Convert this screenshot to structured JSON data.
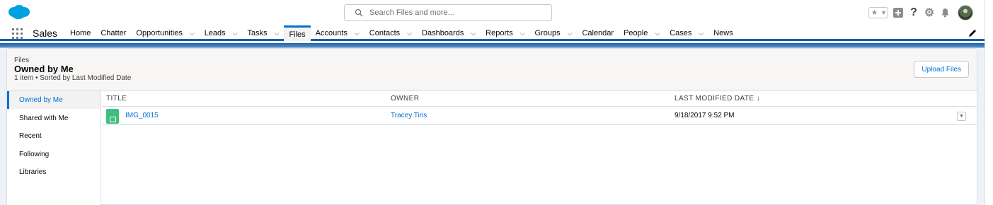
{
  "header": {
    "search_placeholder": "Search Files and more..."
  },
  "nav": {
    "app_name": "Sales",
    "items": [
      {
        "label": "Home",
        "dropdown": false
      },
      {
        "label": "Chatter",
        "dropdown": false
      },
      {
        "label": "Opportunities",
        "dropdown": true
      },
      {
        "label": "Leads",
        "dropdown": true
      },
      {
        "label": "Tasks",
        "dropdown": true
      },
      {
        "label": "Files",
        "dropdown": false,
        "active": true
      },
      {
        "label": "Accounts",
        "dropdown": true
      },
      {
        "label": "Contacts",
        "dropdown": true
      },
      {
        "label": "Dashboards",
        "dropdown": true
      },
      {
        "label": "Reports",
        "dropdown": true
      },
      {
        "label": "Groups",
        "dropdown": true
      },
      {
        "label": "Calendar",
        "dropdown": false
      },
      {
        "label": "People",
        "dropdown": true
      },
      {
        "label": "Cases",
        "dropdown": true
      },
      {
        "label": "News",
        "dropdown": false
      }
    ]
  },
  "page": {
    "breadcrumb": "Files",
    "title": "Owned by Me",
    "meta": "1 item • Sorted by Last Modified Date",
    "upload_label": "Upload Files"
  },
  "sidebar": {
    "items": [
      {
        "label": "Owned by Me",
        "active": true
      },
      {
        "label": "Shared with Me"
      },
      {
        "label": "Recent"
      },
      {
        "label": "Following"
      },
      {
        "label": "Libraries"
      }
    ]
  },
  "table": {
    "columns": [
      "TITLE",
      "OWNER",
      "LAST MODIFIED DATE ↓"
    ],
    "rows": [
      {
        "title": "IMG_0015",
        "owner": "Tracey Tiris",
        "modified": "9/18/2017 9:52 PM"
      }
    ]
  },
  "colors": {
    "brand": "#0070d2",
    "nav_bar": "#1b5fa8",
    "file_icon": "#3fbe7f"
  }
}
